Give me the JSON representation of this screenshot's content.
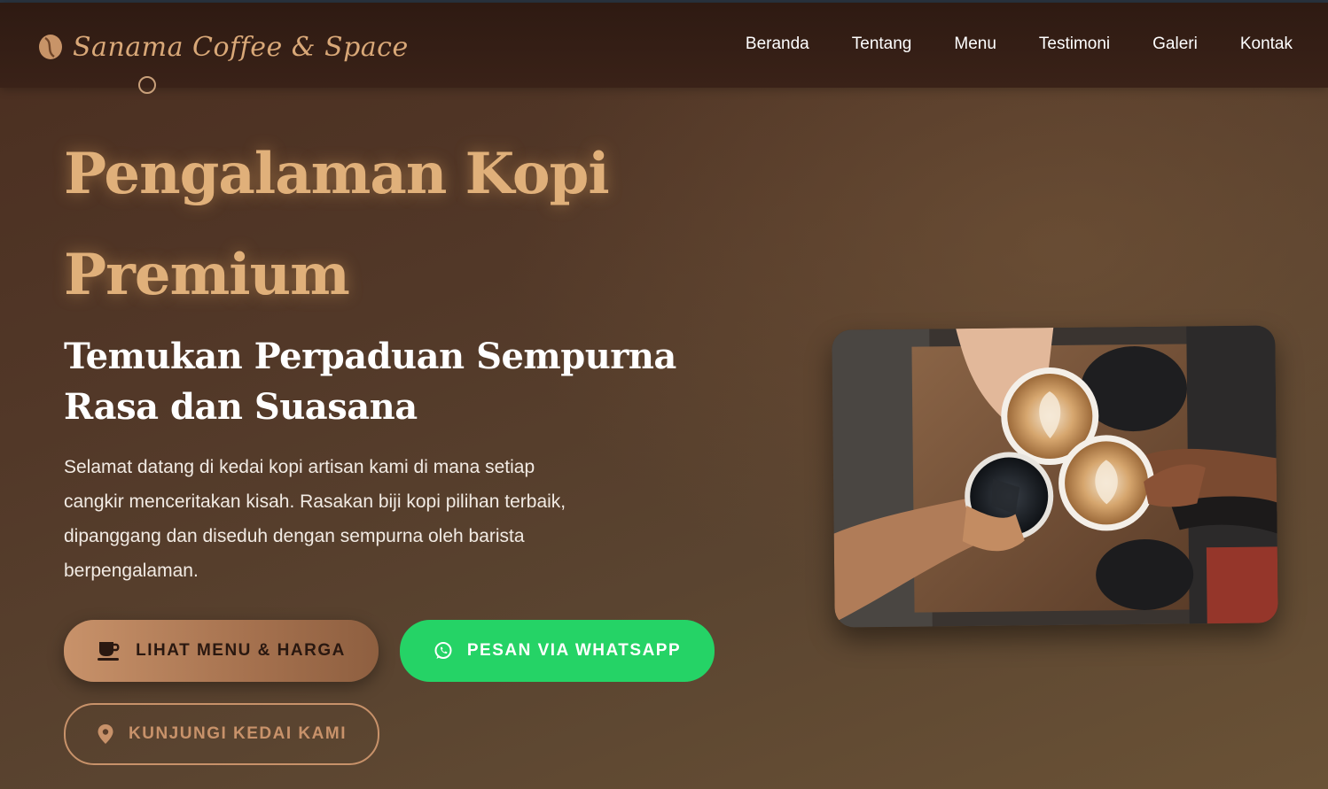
{
  "brand": {
    "name": "Sanama Coffee & Space",
    "icon": "coffee-bean-icon"
  },
  "nav": {
    "items": [
      {
        "label": "Beranda"
      },
      {
        "label": "Tentang"
      },
      {
        "label": "Menu"
      },
      {
        "label": "Testimoni"
      },
      {
        "label": "Galeri"
      },
      {
        "label": "Kontak"
      }
    ]
  },
  "hero": {
    "title": "Pengalaman Kopi Premium",
    "subtitle": "Temukan Perpaduan Sempurna Rasa dan Suasana",
    "description": "Selamat datang di kedai kopi artisan kami di mana setiap cangkir menceritakan kisah. Rasakan biji kopi pilihan terbaik, dipanggang dan diseduh dengan sempurna oleh barista berpengalaman.",
    "buttons": {
      "menu": {
        "label": "LIHAT MENU & HARGA",
        "icon": "coffee-cup-icon"
      },
      "whatsapp": {
        "label": "PESAN VIA WHATSAPP",
        "icon": "whatsapp-icon"
      },
      "visit": {
        "label": "KUNJUNGI KEDAI KAMI",
        "icon": "map-pin-icon"
      }
    },
    "image": {
      "subject": "four coffee cups toasting over wooden table"
    }
  },
  "colors": {
    "accent": "#e0b07a",
    "whatsapp": "#25d366",
    "nav_bg": "#2e1a12",
    "button_outline": "#c8926a"
  }
}
